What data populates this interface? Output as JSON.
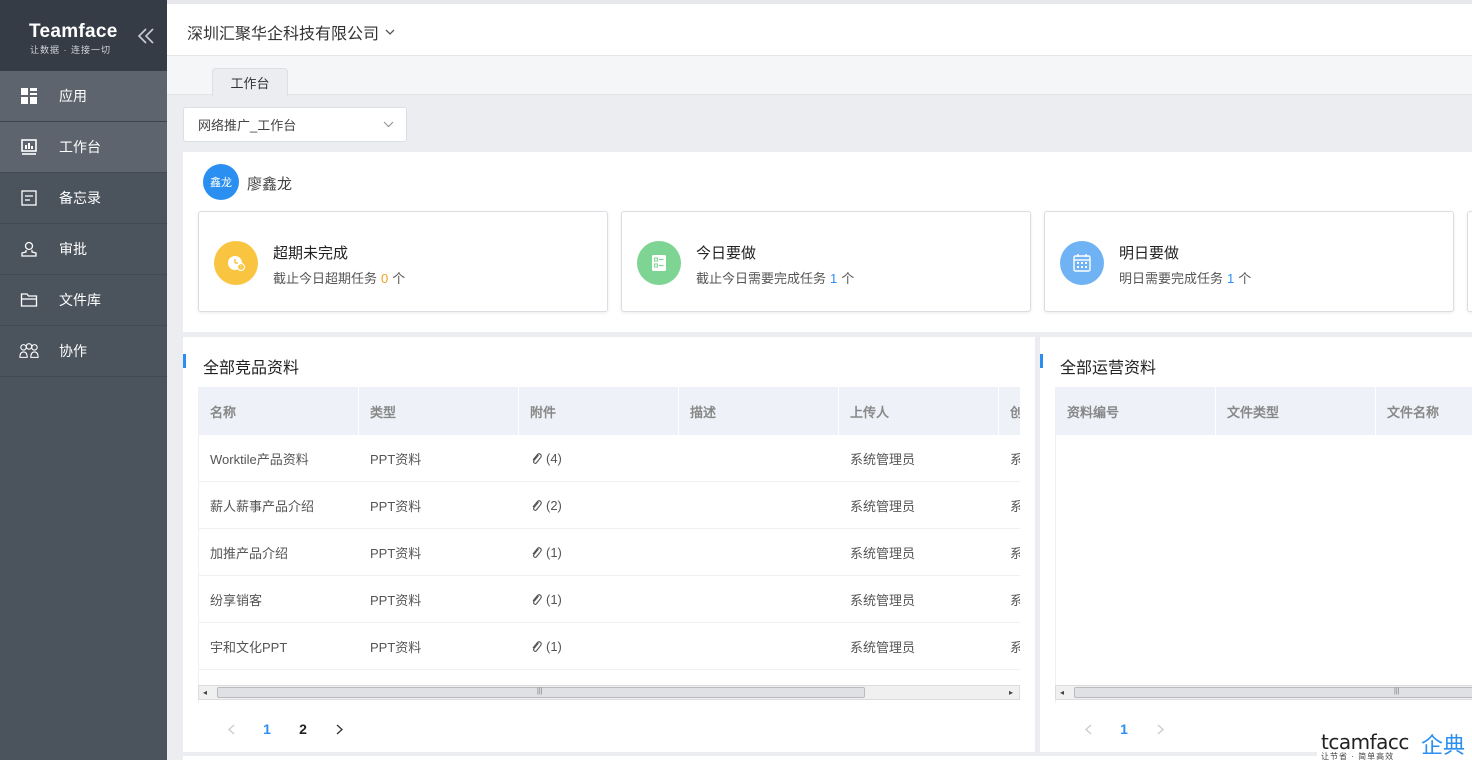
{
  "brand": {
    "title": "Teamface",
    "subtitle": "让数据 · 连接一切"
  },
  "sidebar": {
    "items": [
      {
        "label": "应用",
        "icon": "grid-icon"
      },
      {
        "label": "工作台",
        "icon": "dashboard-icon"
      },
      {
        "label": "备忘录",
        "icon": "memo-icon"
      },
      {
        "label": "审批",
        "icon": "approval-icon"
      },
      {
        "label": "文件库",
        "icon": "folder-icon"
      },
      {
        "label": "协作",
        "icon": "team-icon"
      }
    ],
    "active_index": 1
  },
  "header": {
    "company": "深圳汇聚华企科技有限公司"
  },
  "tabs": [
    {
      "label": "工作台"
    }
  ],
  "workbench_select": {
    "value": "网络推广_工作台"
  },
  "user": {
    "avatar_text": "鑫龙",
    "name": "廖鑫龙"
  },
  "cards": [
    {
      "title": "超期未完成",
      "sub_prefix": "截止今日超期任务",
      "count": "0",
      "unit": "个",
      "color": "#f9c440",
      "count_color": "#f0a020"
    },
    {
      "title": "今日要做",
      "sub_prefix": "截止今日需要完成任务",
      "count": "1",
      "unit": "个",
      "color": "#7ed492",
      "count_color": "#2a8ff0"
    },
    {
      "title": "明日要做",
      "sub_prefix": "明日需要完成任务",
      "count": "1",
      "unit": "个",
      "color": "#6fb3f5",
      "count_color": "#2a8ff0"
    }
  ],
  "panel_left": {
    "title": "全部竞品资料",
    "columns": [
      "名称",
      "类型",
      "附件",
      "描述",
      "上传人",
      "创"
    ],
    "rows": [
      {
        "name": "Worktile产品资料",
        "type": "PPT资料",
        "attach": "(4)",
        "desc": "",
        "uploader": "系统管理员",
        "extra": "系"
      },
      {
        "name": "薪人薪事产品介绍",
        "type": "PPT资料",
        "attach": "(2)",
        "desc": "",
        "uploader": "系统管理员",
        "extra": "系"
      },
      {
        "name": "加推产品介绍",
        "type": "PPT资料",
        "attach": "(1)",
        "desc": "",
        "uploader": "系统管理员",
        "extra": "系"
      },
      {
        "name": "纷享销客",
        "type": "PPT资料",
        "attach": "(1)",
        "desc": "",
        "uploader": "系统管理员",
        "extra": "系"
      },
      {
        "name": "宇和文化PPT",
        "type": "PPT资料",
        "attach": "(1)",
        "desc": "",
        "uploader": "系统管理员",
        "extra": "系"
      }
    ],
    "pages": [
      "1",
      "2"
    ],
    "current_page": "1"
  },
  "panel_right": {
    "title": "全部运营资料",
    "columns": [
      "资料编号",
      "文件类型",
      "文件名称"
    ],
    "pages": [
      "1"
    ],
    "current_page": "1"
  },
  "watermark": {
    "text": "tcamfacc",
    "cn": "企典",
    "sub": "让节省 · 简单高效"
  }
}
